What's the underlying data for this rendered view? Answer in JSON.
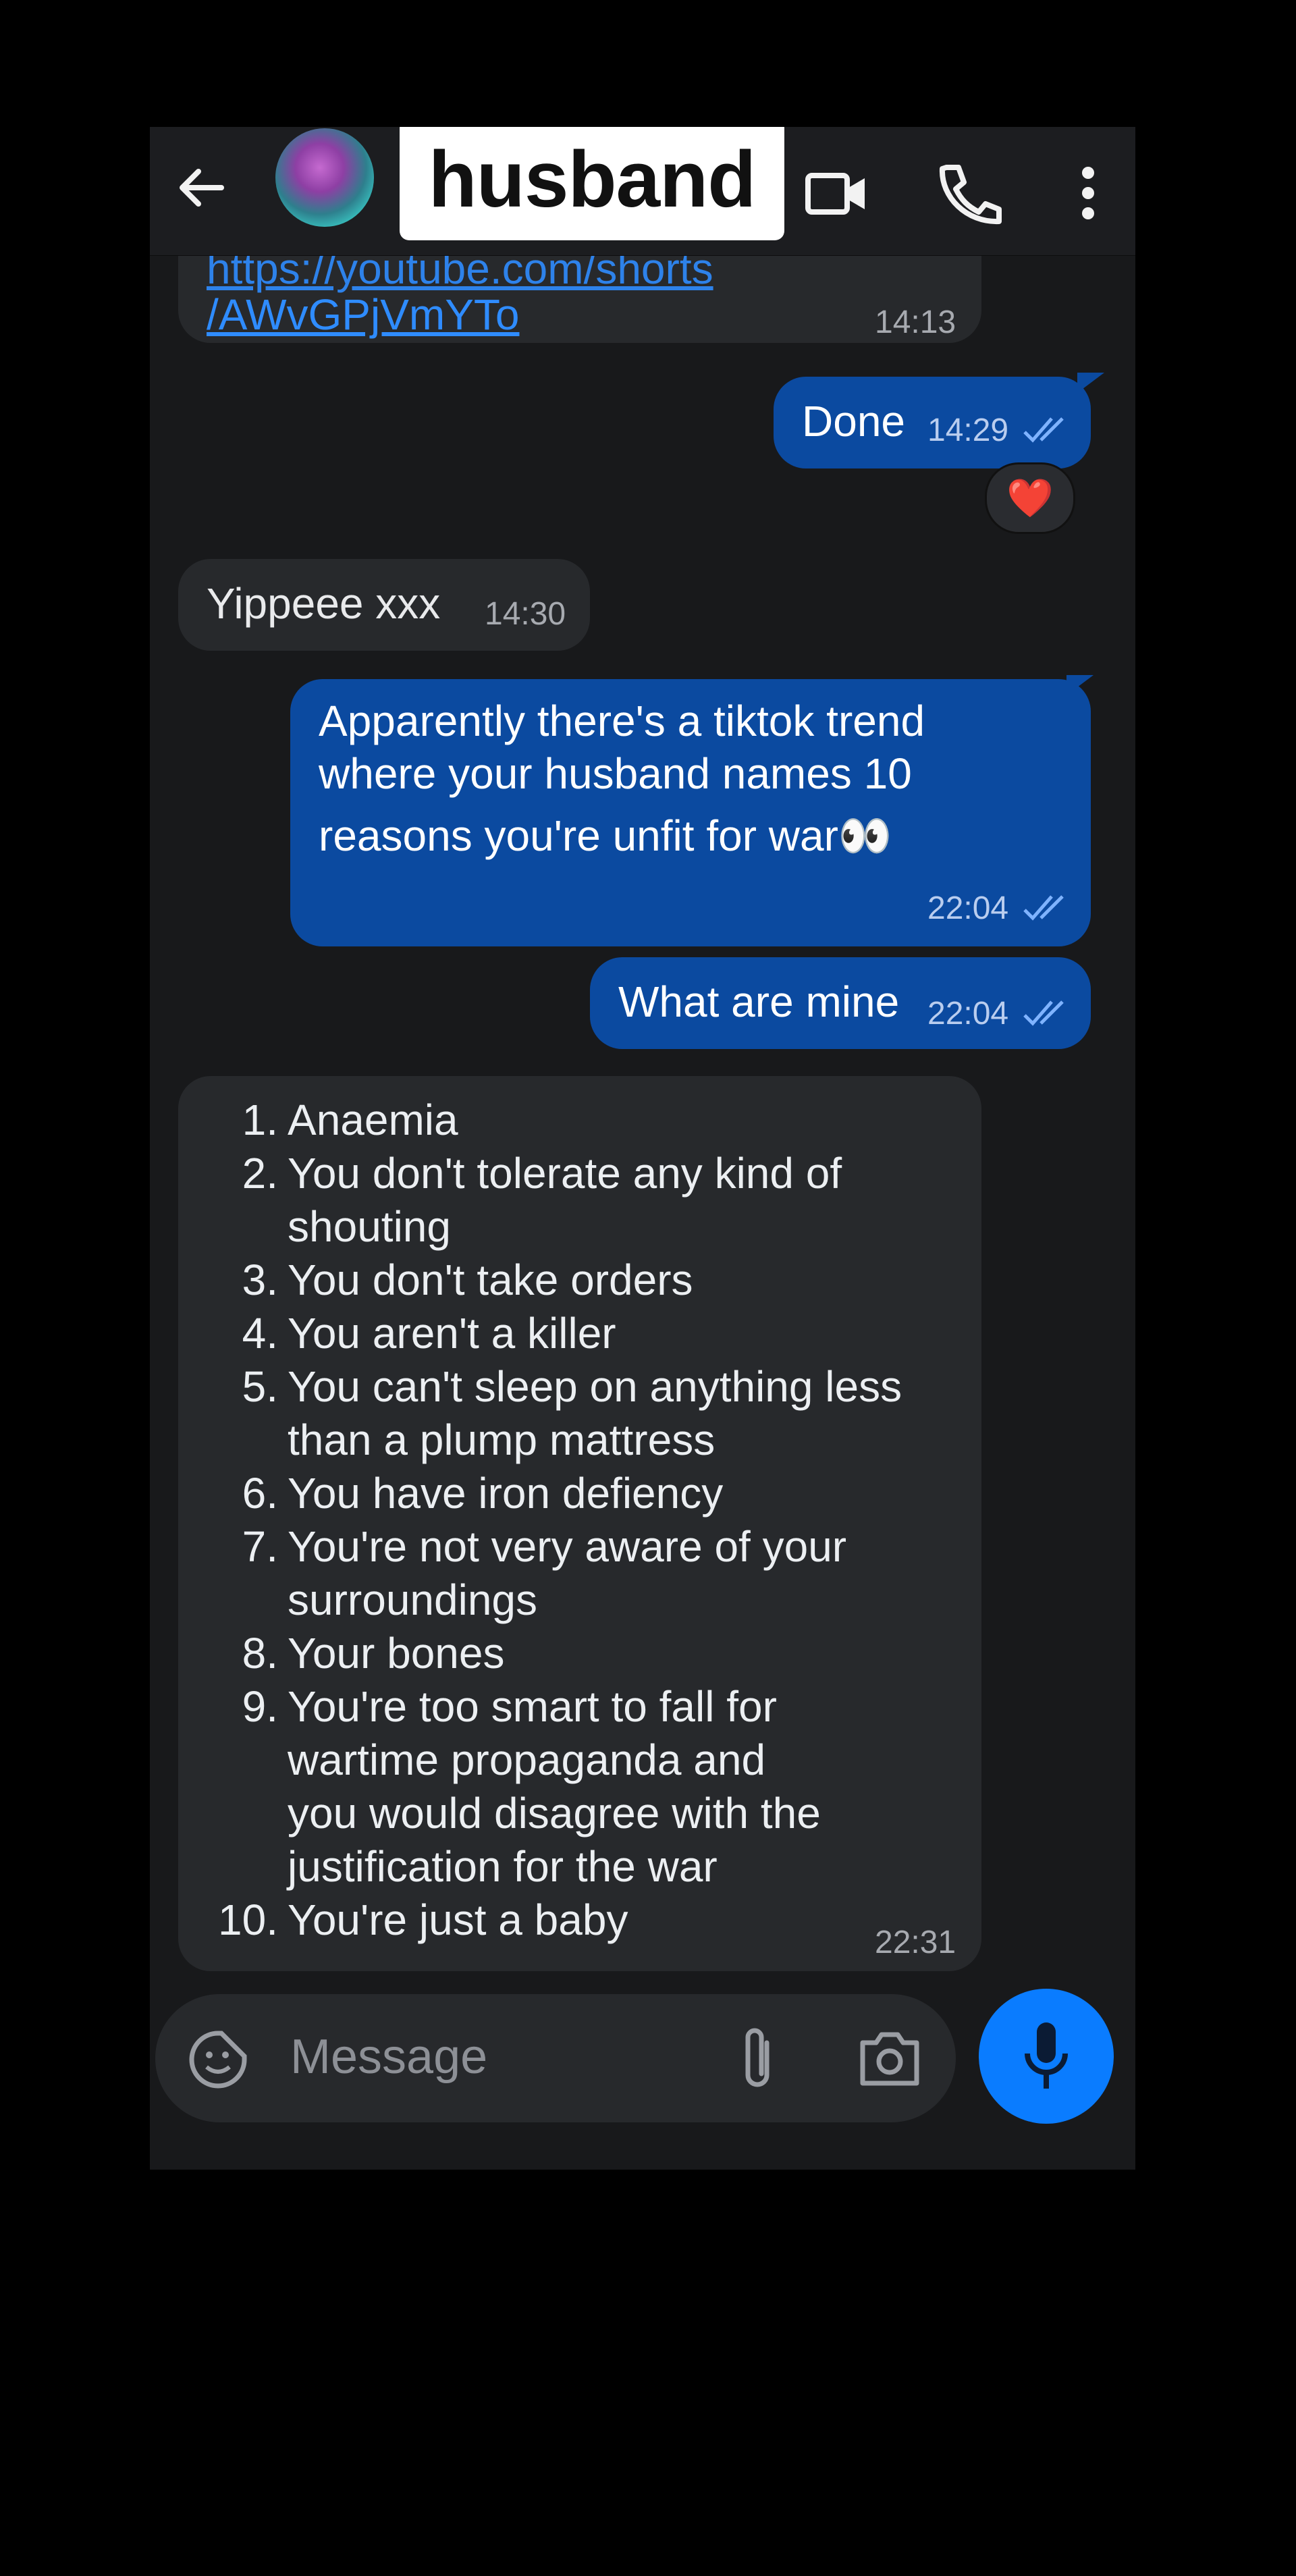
{
  "header": {
    "contact_name": "husband",
    "icons": [
      "arrow-left-icon",
      "avatar",
      "video-camera-icon",
      "phone-icon",
      "more-vertical-icon"
    ]
  },
  "messages": [
    {
      "direction": "in",
      "text_line1": "https://youtube.com/shorts",
      "text_line2": "/AWvGPjVmYTo",
      "time": "14:13"
    },
    {
      "direction": "out",
      "text": "Done",
      "time": "14:29",
      "reaction": "❤️"
    },
    {
      "direction": "in",
      "text": "Yippeee xxx",
      "time": "14:30"
    },
    {
      "direction": "out",
      "text_lines": [
        "Apparently there's a tiktok trend",
        "where your husband names 10",
        "reasons you're unfit for war👀"
      ],
      "time": "22:04"
    },
    {
      "direction": "out",
      "text": "What are mine",
      "time": "22:04"
    },
    {
      "direction": "in",
      "time": "22:31",
      "list": [
        {
          "n": "1.",
          "lines": [
            "Anaemia"
          ]
        },
        {
          "n": "2.",
          "lines": [
            "You don't tolerate any kind of",
            "shouting"
          ]
        },
        {
          "n": "3.",
          "lines": [
            "You don't take orders"
          ]
        },
        {
          "n": "4.",
          "lines": [
            "You aren't a killer"
          ]
        },
        {
          "n": "5.",
          "lines": [
            "You can't sleep on anything less",
            "than a plump mattress"
          ]
        },
        {
          "n": "6.",
          "lines": [
            "You have iron defiency"
          ]
        },
        {
          "n": "7.",
          "lines": [
            "You're not very aware of your",
            "surroundings"
          ]
        },
        {
          "n": "8.",
          "lines": [
            "Your bones"
          ]
        },
        {
          "n": "9.",
          "lines": [
            "You're too smart to fall for",
            "wartime propaganda and",
            "you would disagree with the",
            "justification for the war"
          ]
        },
        {
          "n": "10.",
          "lines": [
            "You're just a baby"
          ]
        }
      ]
    }
  ],
  "composer": {
    "placeholder": "Message",
    "icons": [
      "sticker-icon",
      "paperclip-icon",
      "camera-icon",
      "microphone-icon"
    ]
  },
  "colors": {
    "outgoing": "#0b4aa0",
    "incoming": "#27292c",
    "link": "#2f8cff",
    "accent": "#0a7cff"
  }
}
